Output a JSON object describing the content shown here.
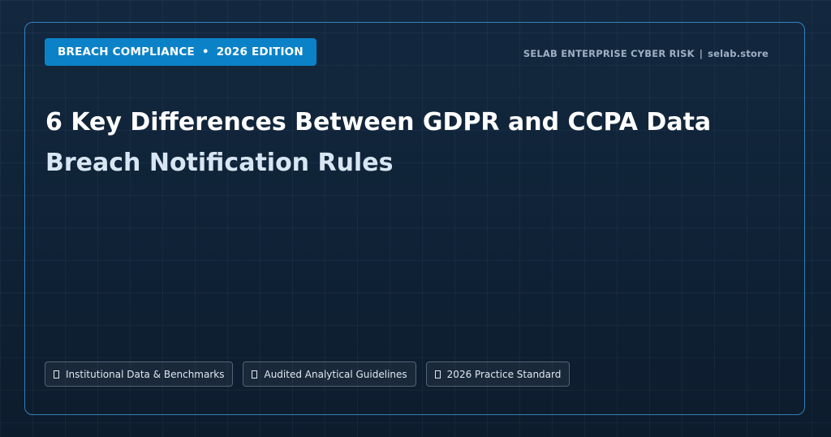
{
  "badge": {
    "left": "BREACH COMPLIANCE",
    "separator": "•",
    "right": "2026 EDITION"
  },
  "brand": {
    "name": "SELAB ENTERPRISE CYBER RISK",
    "separator": "|",
    "site": "selab.store"
  },
  "title": {
    "line1": "6 Key Differences Between GDPR and CCPA Data",
    "line2": "Breach Notification Rules"
  },
  "chips": [
    {
      "icon": "glyph-placeholder-icon",
      "label": "Institutional Data & Benchmarks"
    },
    {
      "icon": "glyph-placeholder-icon",
      "label": "Audited Analytical Guidelines"
    },
    {
      "icon": "glyph-placeholder-icon",
      "label": "2026 Practice Standard"
    }
  ],
  "colors": {
    "background": "#0f1f31",
    "accent": "#0b82c8",
    "border": "#40a0e6"
  }
}
